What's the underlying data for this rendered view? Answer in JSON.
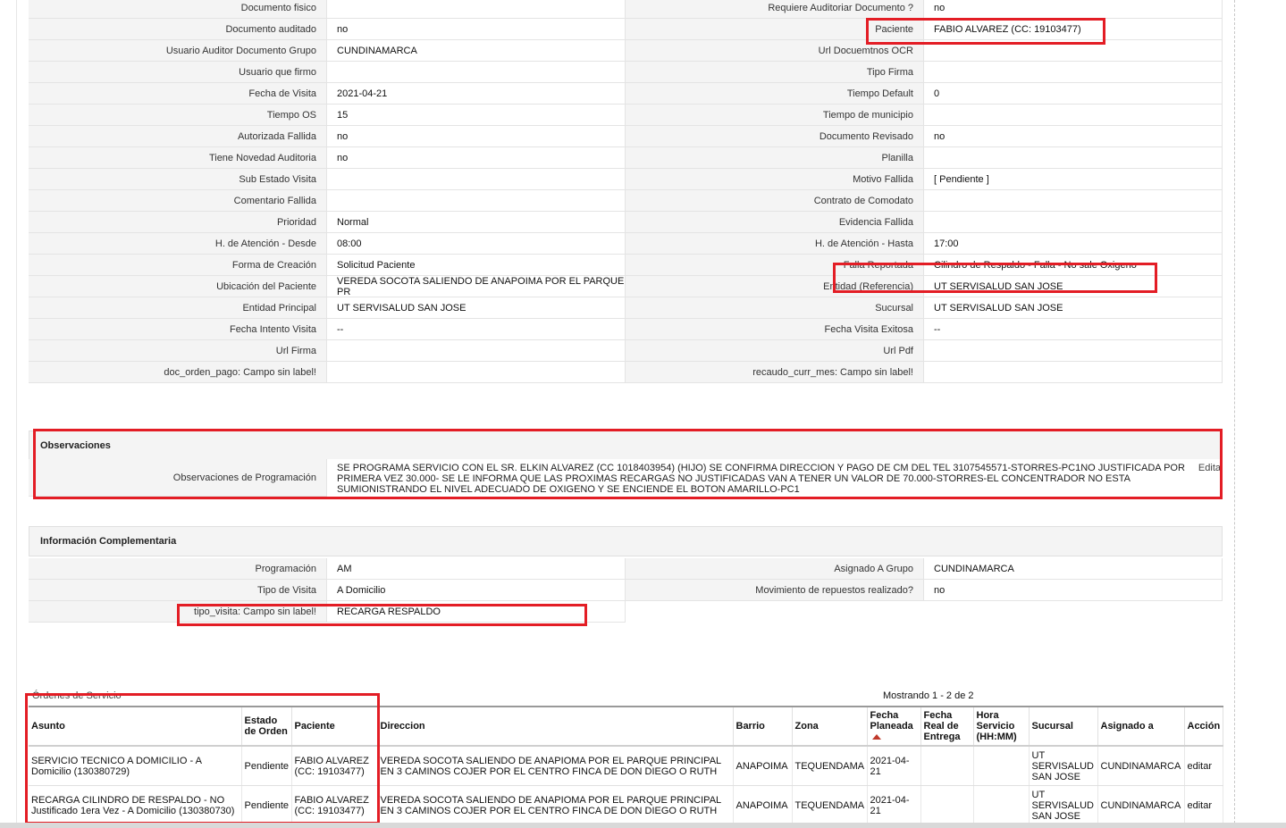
{
  "details": {
    "rows": [
      [
        {
          "label": "Documento fisico",
          "value": ""
        },
        {
          "label": "Requiere Auditoriar Documento ?",
          "value": "no"
        }
      ],
      [
        {
          "label": "Documento auditado",
          "value": "no"
        },
        {
          "label": "Paciente",
          "value": "FABIO ALVAREZ (CC: 19103477)"
        }
      ],
      [
        {
          "label": "Usuario Auditor Documento Grupo",
          "value": "CUNDINAMARCA"
        },
        {
          "label": "Url Docuemtnos OCR",
          "value": ""
        }
      ],
      [
        {
          "label": "Usuario que firmo",
          "value": ""
        },
        {
          "label": "Tipo Firma",
          "value": ""
        }
      ],
      [
        {
          "label": "Fecha de Visita",
          "value": "2021-04-21"
        },
        {
          "label": "Tiempo Default",
          "value": "0"
        }
      ],
      [
        {
          "label": "Tiempo OS",
          "value": "15"
        },
        {
          "label": "Tiempo de municipio",
          "value": ""
        }
      ],
      [
        {
          "label": "Autorizada Fallida",
          "value": "no"
        },
        {
          "label": "Documento Revisado",
          "value": "no"
        }
      ],
      [
        {
          "label": "Tiene Novedad Auditoria",
          "value": "no"
        },
        {
          "label": "Planilla",
          "value": ""
        }
      ],
      [
        {
          "label": "Sub Estado Visita",
          "value": ""
        },
        {
          "label": "Motivo Fallida",
          "value": "[ Pendiente ]"
        }
      ],
      [
        {
          "label": "Comentario Fallida",
          "value": ""
        },
        {
          "label": "Contrato de Comodato",
          "value": ""
        }
      ],
      [
        {
          "label": "Prioridad",
          "value": "Normal"
        },
        {
          "label": "Evidencia Fallida",
          "value": ""
        }
      ],
      [
        {
          "label": "H. de Atención - Desde",
          "value": "08:00"
        },
        {
          "label": "H. de Atención - Hasta",
          "value": "17:00"
        }
      ],
      [
        {
          "label": "Forma de Creación",
          "value": "Solicitud Paciente"
        },
        {
          "label": "Falla Reportada",
          "value": "Cilindro de Respaldo - Falla - No sale Oxigeno"
        }
      ],
      [
        {
          "label": "Ubicación del Paciente",
          "value": "VEREDA SOCOTA SALIENDO DE ANAPOIMA POR EL PARQUE PR"
        },
        {
          "label": "Entidad (Referencia)",
          "value": "UT SERVISALUD SAN JOSE"
        }
      ],
      [
        {
          "label": "Entidad Principal",
          "value": "UT SERVISALUD SAN JOSE"
        },
        {
          "label": "Sucursal",
          "value": "UT SERVISALUD SAN JOSE"
        }
      ],
      [
        {
          "label": "Fecha Intento Visita",
          "value": "--"
        },
        {
          "label": "Fecha Visita Exitosa",
          "value": "--"
        }
      ],
      [
        {
          "label": "Url Firma",
          "value": ""
        },
        {
          "label": "Url Pdf",
          "value": ""
        }
      ],
      [
        {
          "label": "doc_orden_pago: Campo sin label!",
          "value": ""
        },
        {
          "label": "recaudo_curr_mes: Campo sin label!",
          "value": ""
        }
      ]
    ]
  },
  "observaciones": {
    "title": "Observaciones",
    "label": "Observaciones de Programación",
    "text": "SE PROGRAMA SERVICIO CON EL SR. ELKIN ALVAREZ (CC 1018403954) (HIJO) SE CONFIRMA DIRECCION Y PAGO DE CM DEL TEL 3107545571-STORRES-PC1NO JUSTIFICADA POR PRIMERA VEZ 30.000- SE LE INFORMA QUE LAS PROXIMAS RECARGAS NO JUSTIFICADAS VAN A TENER UN VALOR DE 70.000-STORRES-EL CONCENTRADOR NO ESTA SUMIONISTRANDO EL NIVEL ADECUADO DE OXIGENO Y SE ENCIENDE EL BOTON AMARILLO-PC1",
    "edit_label": "Edita"
  },
  "complementaria": {
    "title": "Información Complementaria",
    "row1": [
      {
        "label": "Programación",
        "value": "AM"
      },
      {
        "label": "Asignado A Grupo",
        "value": "CUNDINAMARCA"
      }
    ],
    "row2": [
      {
        "label": "Tipo de Visita",
        "value": "A Domicilio"
      },
      {
        "label": "Movimiento de repuestos realizado?",
        "value": "no"
      }
    ],
    "row3": {
      "label": "tipo_visita: Campo sin label!",
      "value": "RECARGA RESPALDO"
    }
  },
  "ordenes": {
    "title": "Órdenes de Servicio",
    "count_text": "Mostrando 1 - 2 de 2",
    "headers": {
      "asunto": "Asunto",
      "estado": "Estado de Orden",
      "paciente": "Paciente",
      "direccion": "Direccion",
      "barrio": "Barrio",
      "zona": "Zona",
      "fecha_planeada": "Fecha Planeada",
      "fecha_real": "Fecha Real de Entrega",
      "hora": "Hora Servicio (HH:MM)",
      "sucursal": "Sucursal",
      "asignado": "Asignado a",
      "accion": "Acción"
    },
    "rows": [
      {
        "asunto": "SERVICIO TECNICO A DOMICILIO - A Domicilio (130380729)",
        "estado": "Pendiente",
        "paciente": "FABIO ALVAREZ (CC: 19103477)",
        "direccion": "VEREDA SOCOTA SALIENDO DE ANAPIOMA POR EL PARQUE PRINCIPAL EN 3 CAMINOS COJER POR EL CENTRO FINCA DE DON DIEGO O RUTH",
        "barrio": "ANAPOIMA",
        "zona": "TEQUENDAMA",
        "fecha_planeada": "2021-04-21",
        "fecha_real": "",
        "hora": "",
        "sucursal": "UT SERVISALUD SAN JOSE",
        "asignado": "CUNDINAMARCA",
        "accion": "editar"
      },
      {
        "asunto": "RECARGA CILINDRO DE RESPALDO - NO Justificado 1era Vez - A Domicilio (130380730)",
        "estado": "Pendiente",
        "paciente": "FABIO ALVAREZ (CC: 19103477)",
        "direccion": "VEREDA SOCOTA SALIENDO DE ANAPIOMA POR EL PARQUE PRINCIPAL EN 3 CAMINOS COJER POR EL CENTRO FINCA DE DON DIEGO O RUTH",
        "barrio": "ANAPOIMA",
        "zona": "TEQUENDAMA",
        "fecha_planeada": "2021-04-21",
        "fecha_real": "",
        "hora": "",
        "sucursal": "UT SERVISALUD SAN JOSE",
        "asignado": "CUNDINAMARCA",
        "accion": "editar"
      }
    ]
  },
  "colors": {
    "highlight": "#e31d25",
    "label_bg": "#f4f4f4"
  }
}
